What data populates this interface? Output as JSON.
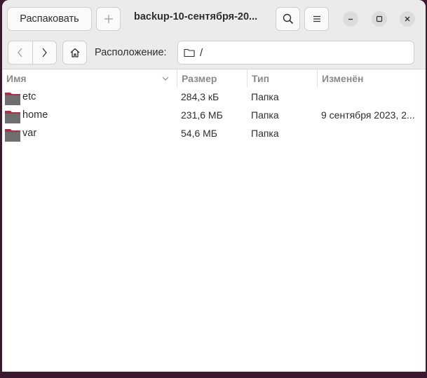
{
  "header": {
    "extract_label": "Распаковать",
    "title": "backup-10-сентября-20..."
  },
  "location": {
    "label": "Расположение:",
    "path": "/"
  },
  "columns": {
    "name": "Имя",
    "size": "Размер",
    "type": "Тип",
    "modified": "Изменён"
  },
  "rows": [
    {
      "name": "etc",
      "size": "284,3 кБ",
      "type": "Папка",
      "modified": ""
    },
    {
      "name": "home",
      "size": "231,6 МБ",
      "type": "Папка",
      "modified": "9 сентября 2023, 2..."
    },
    {
      "name": "var",
      "size": "54,6 МБ",
      "type": "Папка",
      "modified": ""
    }
  ],
  "icons": {
    "add": "plus-icon",
    "search": "search-icon",
    "menu": "hamburger-menu-icon",
    "minimize": "minimize-icon",
    "maximize": "maximize-icon",
    "close": "close-icon",
    "back": "chevron-left-icon",
    "forward": "chevron-right-icon",
    "home": "home-icon",
    "folder": "folder-icon"
  },
  "colors": {
    "folder_tab": "#a8324a",
    "folder_body": "#6e6e6e",
    "desktop_bg": "#3b1a2f"
  }
}
